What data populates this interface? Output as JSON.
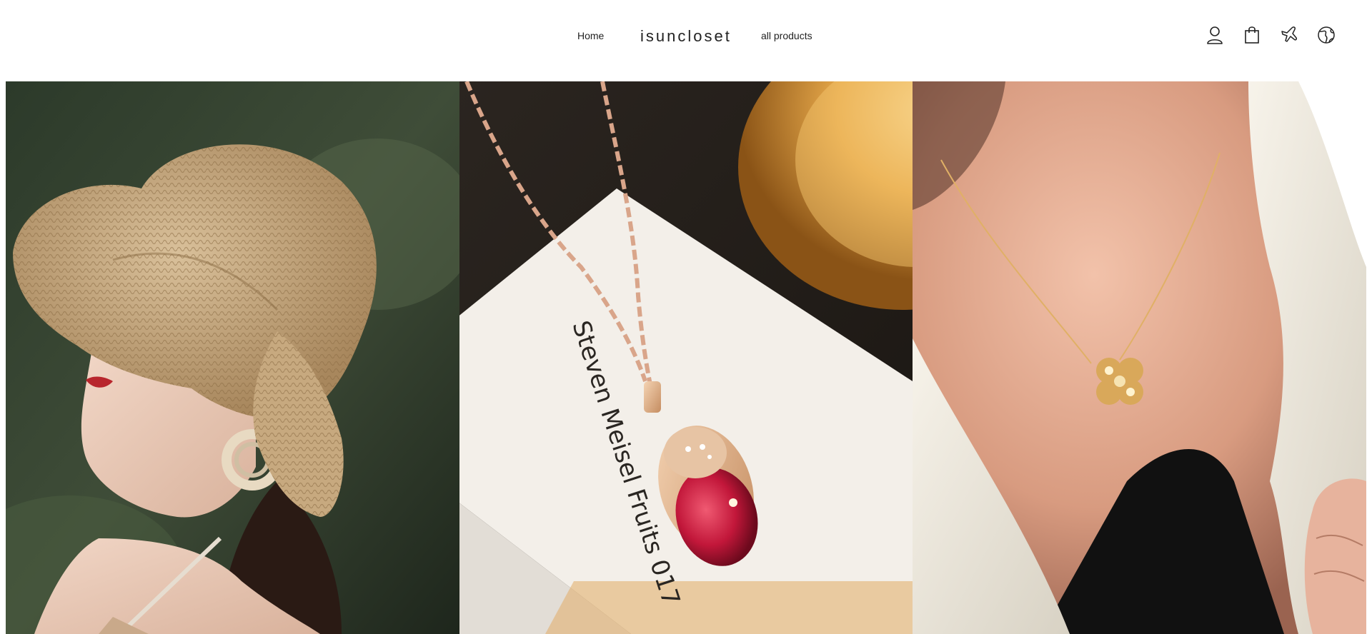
{
  "header": {
    "logo": "isuncloset",
    "nav": {
      "home": "Home",
      "all_products": "all products"
    },
    "icons": [
      "account-icon",
      "cart-icon",
      "airplane-icon",
      "globe-icon"
    ]
  },
  "gallery": {
    "panels": [
      {
        "name": "straw-hat-photo",
        "caption_text": ""
      },
      {
        "name": "ruby-pixiu-pendant-photo",
        "caption_text": "Steven Meisel Fruits 017"
      },
      {
        "name": "clover-necklace-photo",
        "caption_text": ""
      }
    ]
  },
  "colors": {
    "background": "#ffffff",
    "text": "#222222"
  }
}
